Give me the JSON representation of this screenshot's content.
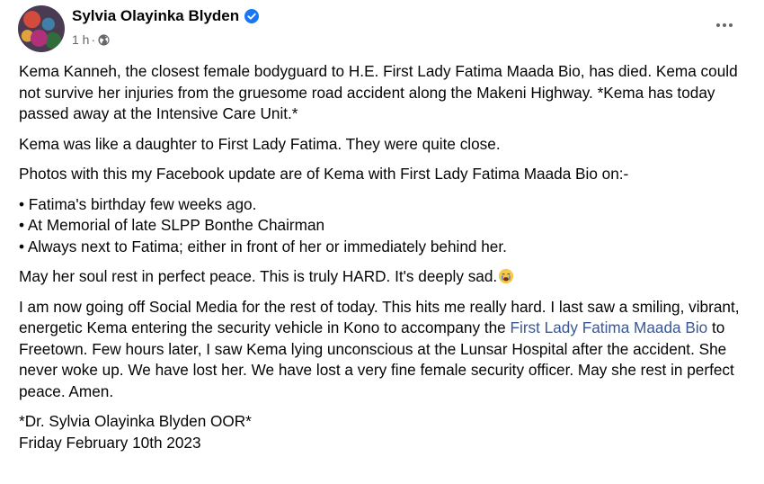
{
  "post": {
    "author": "Sylvia Olayinka Blyden",
    "time": "1 h",
    "separator": "·",
    "privacy_icon": "globe-icon",
    "verified_icon": "verified-badge-icon",
    "more_icon": "more-options-icon",
    "paragraphs": {
      "p1": "Kema Kanneh, the closest female bodyguard to H.E. First Lady Fatima Maada Bio, has died. Kema could not survive her injuries from the gruesome road accident along the Makeni Highway. *Kema has today passed away at the Intensive Care Unit.*",
      "p2": "Kema was like a daughter to First Lady Fatima. They were quite close.",
      "p3": "Photos with this my Facebook update are of Kema with First Lady Fatima Maada Bio on:-",
      "bullets": [
        "• Fatima's birthday few weeks ago.",
        "• At Memorial of late SLPP Bonthe Chairman",
        "• Always next to Fatima; either in front of her or immediately behind her."
      ],
      "p4": "May her soul rest in perfect peace. This is truly HARD. It's deeply sad.",
      "p5_before": "I am now going off Social Media for the rest of today. This hits me really hard. I last saw a smiling, vibrant, energetic Kema entering the security vehicle in Kono to accompany the ",
      "p5_link": "First Lady Fatima Maada Bio",
      "p5_after": " to Freetown. Few hours later, I saw Kema lying unconscious at the Lunsar Hospital after the accident. She never woke up. We have lost her. We have lost a very fine female security officer. May she rest in perfect peace. Amen.",
      "signature": "*Dr. Sylvia Olayinka Blyden OOR*",
      "date": "Friday February 10th 2023"
    },
    "emoji": "crying-face-emoji",
    "colors": {
      "verified": "#1877f2",
      "link": "#385898",
      "meta": "#65676b"
    }
  }
}
